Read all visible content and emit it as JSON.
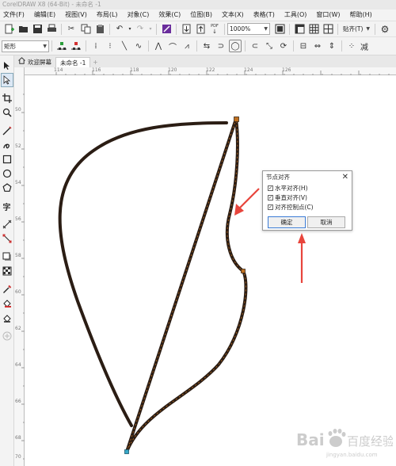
{
  "window": {
    "title": "CorelDRAW X8 (64-Bit) - 未命名 -1"
  },
  "menu": [
    "文件(F)",
    "编辑(E)",
    "视图(V)",
    "布局(L)",
    "对象(C)",
    "效果(C)",
    "位图(B)",
    "文本(X)",
    "表格(T)",
    "工具(O)",
    "窗口(W)",
    "帮助(H)"
  ],
  "toolbar": {
    "zoom_value": "1000%",
    "snap_label": "贴齐(T)",
    "pdf_label": "PDF"
  },
  "property_bar": {
    "shape_select_value": "矩形",
    "extra_label": "减"
  },
  "tabs": {
    "welcome": "欢迎屏幕",
    "document": "未命名 -1"
  },
  "rulers": {
    "h": [
      "114",
      "116",
      "118",
      "120",
      "122",
      "124",
      "126"
    ],
    "v": [
      "50",
      "52",
      "54",
      "56",
      "58",
      "60",
      "62",
      "64",
      "66",
      "68",
      "70"
    ]
  },
  "dialog": {
    "title": "节点对齐",
    "options": [
      {
        "label": "水平对齐(H)",
        "checked": true
      },
      {
        "label": "垂直对齐(V)",
        "checked": true
      },
      {
        "label": "对齐控制点(C)",
        "checked": true
      }
    ],
    "ok_label": "确定",
    "cancel_label": "取消"
  },
  "colors": {
    "curve": "#2b1d14",
    "node": "#c07020",
    "arrow": "#e8453c",
    "watermark": "#cccccc"
  },
  "watermark": {
    "brand": "Bai",
    "site": "jingyan.baidu.com",
    "label": "百度经验"
  }
}
